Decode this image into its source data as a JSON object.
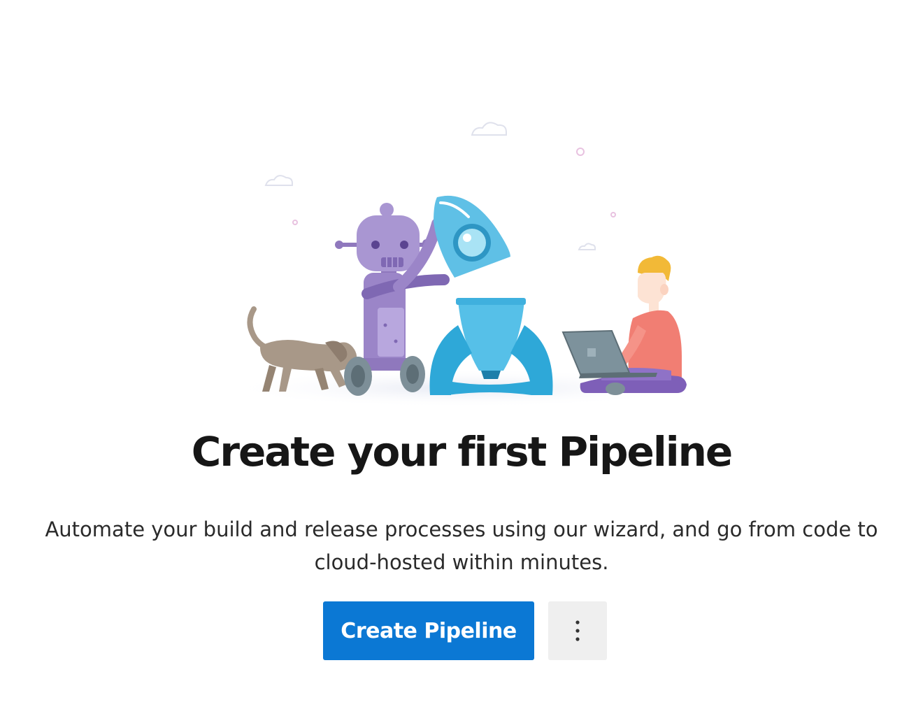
{
  "empty_state": {
    "title": "Create your first Pipeline",
    "description": "Automate your build and release processes using our wizard, and go from code to cloud-hosted within minutes.",
    "primary_button_label": "Create Pipeline",
    "more_options_icon": "more-vertical-icon",
    "illustration": "robot-rocket-developer-illustration"
  },
  "colors": {
    "primary_button": "#0b78d4",
    "secondary_button": "#efefef",
    "title_text": "#161616",
    "robot": "#9b85c8",
    "rocket": "#2ea8d8",
    "dog": "#a89888",
    "developer_shirt": "#f17e73",
    "developer_hair": "#f2b937",
    "laptop": "#6f8590"
  }
}
